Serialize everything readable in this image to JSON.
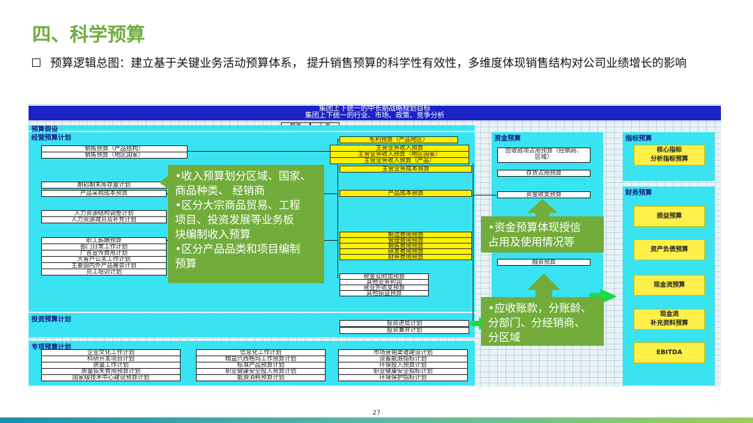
{
  "title": "四、科学预算",
  "bullet": "预算逻辑总图：建立基于关键业务活动预算体系， 提升销售预算的科学性有效性，多维度体现销售结构对公司业绩增长的影响",
  "header": {
    "line1": "集团上下统一的中长期战略规划目标",
    "line2": "集团上下统一的行业、市场、政策、竞争分析"
  },
  "rates": {
    "tax": "税率",
    "fx": "汇率"
  },
  "sections": {
    "assumptions": "预算假设",
    "operating": "经营预算计划",
    "investment": "投资预算计划",
    "special": "专项预算计划",
    "capital": "资金预算",
    "indicator": "指标预算",
    "financial": "财务预算"
  },
  "left_boxes": {
    "sales1": "销售预算（产品结构）",
    "sales2": "销售预算（地区国家）",
    "inventory": "期初期末库存量计划",
    "purchase": "产品采购成本预算",
    "hr1": "人力资源结构调整计划",
    "hr2": "人力资源减员及补充计划",
    "staff": [
      "职工薪酬预算",
      "部门日常工作计划",
      "广告宣传费用计划",
      "大客户公关工作计划",
      "主要国内外产品展会计划",
      "员工培训计划"
    ]
  },
  "mid_boxes": {
    "gross": "毛利预算（产品地区）",
    "revenue": [
      "主营业务收入预算",
      "主营业务收入预算（地区国家）",
      "主营业务收入预算（产品）"
    ],
    "cost": "主营业务成本预算",
    "product_cost": "产品成本预算",
    "expenses": [
      "制造费用预算",
      "管理费用预算",
      "销售费用预算",
      "研发费用预算",
      "财务费用预算"
    ],
    "other": [
      "税金及附加预算",
      "其他业务利润",
      "营业外收支预算",
      "其他损益预算"
    ],
    "invest": [
      "投资进度计划",
      "投资兼并计划"
    ]
  },
  "capital_boxes": {
    "receivable": "应收款项占用预算（经销商、区域）",
    "inventory_occ": "存货占用预算",
    "cashflow": "资金收支预算",
    "financing": "融资预算"
  },
  "indicator_boxes": {
    "core": "核心指标\n分析指标预算"
  },
  "financial_boxes": [
    "损益预算",
    "资产负债预算",
    "现金流预算",
    "现金流\n补充资料预算",
    "EBITDA"
  ],
  "special_boxes": {
    "col1": [
      "企业文化工作计划",
      "科研开发项目计划",
      "质量工作计划",
      "质量损失费用预算计划",
      "国家级技术中心建设预算计划"
    ],
    "col2": [
      "信息化工作计划",
      "精益六西格玛工作预算计划",
      "标准产品预算计划",
      "职业健康安全投入预算计划",
      "能源消耗预算计划"
    ],
    "col3": [
      "市场营销渠道建设计划",
      "设备能源指标计划",
      "环保投入预算计划",
      "职业健康安全指标计划",
      "环境保护指标计划"
    ]
  },
  "callouts": {
    "revenue": "•收入预算划分区域、国家、\n  商品种类、 经销商\n•区分大宗商品贸易、工程\n  项目、投资发展等业务板\n  块编制收入预算\n•区分产品品类和项目编制\n  预算",
    "capital": "•资金预算体现授信\n  占用及使用情况等",
    "receivable": "•应收账款，分账龄、\n  分部门、分经销商、\n  分区域"
  },
  "page_number": "27"
}
